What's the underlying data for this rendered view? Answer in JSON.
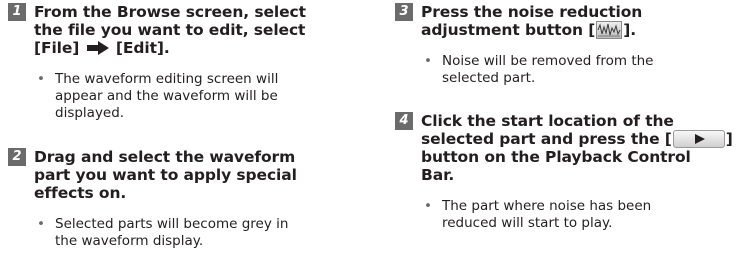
{
  "steps": [
    {
      "number": "1",
      "title_lines": [
        "From the Browse screen, select",
        "the file you want to edit, select"
      ],
      "menu_file": "[File]",
      "menu_edit": "[Edit].",
      "bullet_lines": [
        "The waveform editing screen will",
        "appear and the waveform will be",
        "displayed."
      ]
    },
    {
      "number": "2",
      "title_lines": [
        "Drag and select the waveform",
        "part you want to apply special",
        "effects on."
      ],
      "bullet_lines": [
        "Selected parts will become grey in",
        "the waveform display."
      ]
    },
    {
      "number": "3",
      "title_line1": "Press the noise reduction",
      "title_line2_before": "adjustment button [",
      "title_line2_after": "].",
      "bullet_lines": [
        "Noise will be removed from the",
        "selected part."
      ]
    },
    {
      "number": "4",
      "title_line1": "Click the start location of the",
      "title_line2_before": "selected part and press the [",
      "title_line2_after": "]",
      "title_line3": "button on the Playback Control",
      "title_line4": "Bar.",
      "bullet_lines": [
        "The part where noise has been",
        "reduced will start to play."
      ]
    }
  ],
  "bullet_symbol": "•",
  "icons": {
    "arrow": "arrow-right-icon",
    "noise": "noise-reduction-icon",
    "play": "play-icon"
  },
  "colors": {
    "number_badge": "#6b6b6b",
    "text": "#231f20"
  }
}
